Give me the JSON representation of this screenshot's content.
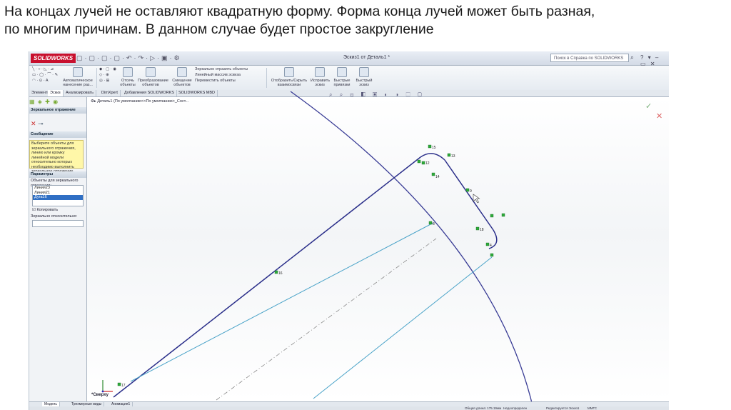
{
  "slide": {
    "line1": "На концах лучей не оставляют квадратную форму. Форма конца лучей может быть разная,",
    "line2": "по многим причинам. В данном случае будет простое закругление"
  },
  "titlebar": {
    "logo": "SOLIDWORKS",
    "doc_title": "Эскиз1 от Деталь1 *",
    "search_placeholder": "Поиск в Справка по SOLIDWORKS",
    "search_icon": "search-icon"
  },
  "ribbon": {
    "auto_size": "Автоматическое нанесение раз...",
    "trim": "Отсечь объекты",
    "convert": "Преобразование объектов",
    "offset": "Смещение объектов",
    "mirror": "Зеркально отразить объекты",
    "linear_pattern": "Линейный массив эскиза",
    "move": "Переместить объекты",
    "show_hide": "Отобразить/Скрыть взаимосвязи",
    "repair": "Исправить эскиз",
    "quick_snaps": "Быстрые привязки",
    "rapid_sketch": "Быстрый эскиз"
  },
  "tabs": [
    "Элементы",
    "Эскиз",
    "Анализировать",
    "DimXpert",
    "Добавления SOLIDWORKS",
    "SOLIDWORKS MBD"
  ],
  "feature_manager": {
    "header": "Зеркальное отражение",
    "message_header": "Сообщение",
    "message": "Выберите объекты для зеркального отражения, линию или кромку линейной модели относительно которых необходимо выполнить зеркальное отражение",
    "params_header": "Параметры",
    "entities_label": "Объекты для зеркального отражения:",
    "entities": [
      "Линия23",
      "Линия21",
      "Дуга16"
    ],
    "copy_label": "Копировать",
    "mirror_about_label": "Зеркально относительно:"
  },
  "viewport": {
    "tree_root": "Деталь1 (По умолчанию<<По умолчанию>_Сост...",
    "view_label": "*Сверху",
    "points": [
      "15",
      "13",
      "12",
      "11",
      "14",
      "12",
      "9",
      "8",
      "18",
      "4",
      "6",
      "16",
      "17"
    ]
  },
  "bottom_tabs": [
    "Модель",
    "Трехмерные виды",
    "Анимация1"
  ],
  "status": {
    "length": "Общая длина: 175.19мм",
    "defined": "Недоопределен",
    "editing": "Редактируется Эскиз1",
    "units": "ММГС"
  },
  "colors": {
    "sketch_line": "#2b2f8a",
    "construction_line": "#4aa3c8",
    "point_marker": "#2eaa3a",
    "centerline": "#8a8a8a"
  }
}
